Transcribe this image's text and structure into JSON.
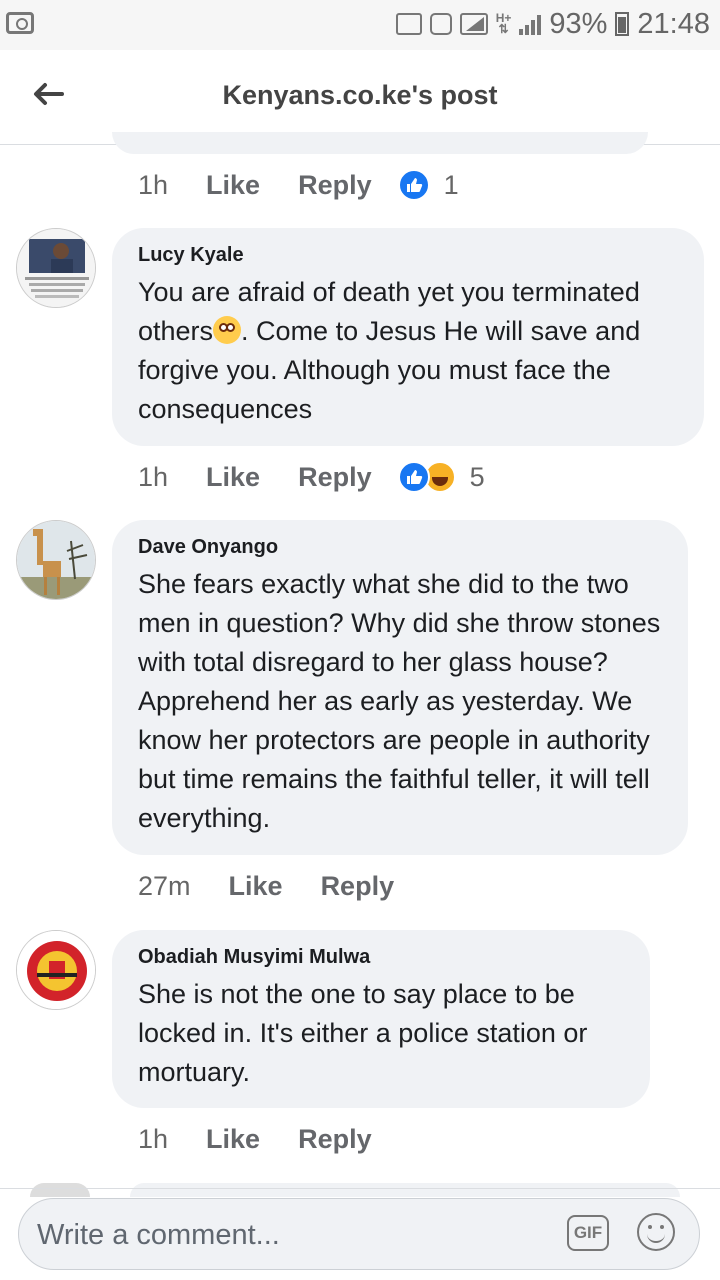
{
  "status_bar": {
    "battery": "93%",
    "time": "21:48",
    "network": "H+"
  },
  "header": {
    "title": "Kenyans.co.ke's post",
    "back_icon": "back-arrow-icon"
  },
  "comments": [
    {
      "time": "1h",
      "like": "Like",
      "reply": "Reply",
      "reaction_count": "1"
    },
    {
      "author": "Lucy Kyale",
      "text_before_emoji": "You are afraid of death yet you terminated others",
      "text_after_emoji": ". Come to Jesus He will save and forgive you. Although you must face the consequences",
      "emoji": "flushed-face-emoji",
      "time": "1h",
      "like": "Like",
      "reply": "Reply",
      "reaction_count": "5"
    },
    {
      "author": "Dave Onyango",
      "text": "She fears exactly what she did to the two men in question? Why did she throw stones with total disregard to her glass house? Apprehend her as early as yesterday. We know her protectors are people in authority but time remains the faithful teller, it will tell everything.",
      "time": "27m",
      "like": "Like",
      "reply": "Reply"
    },
    {
      "author": "Obadiah Musyimi Mulwa",
      "text": "She is not the one to say place to be locked in. It's either a police station or mortuary.",
      "time": "1h",
      "like": "Like",
      "reply": "Reply"
    }
  ],
  "composer": {
    "placeholder": "Write a comment...",
    "gif_label": "GIF"
  },
  "colors": {
    "accent": "#1877f2",
    "bubble": "#f0f2f5",
    "meta_text": "#65676b"
  }
}
